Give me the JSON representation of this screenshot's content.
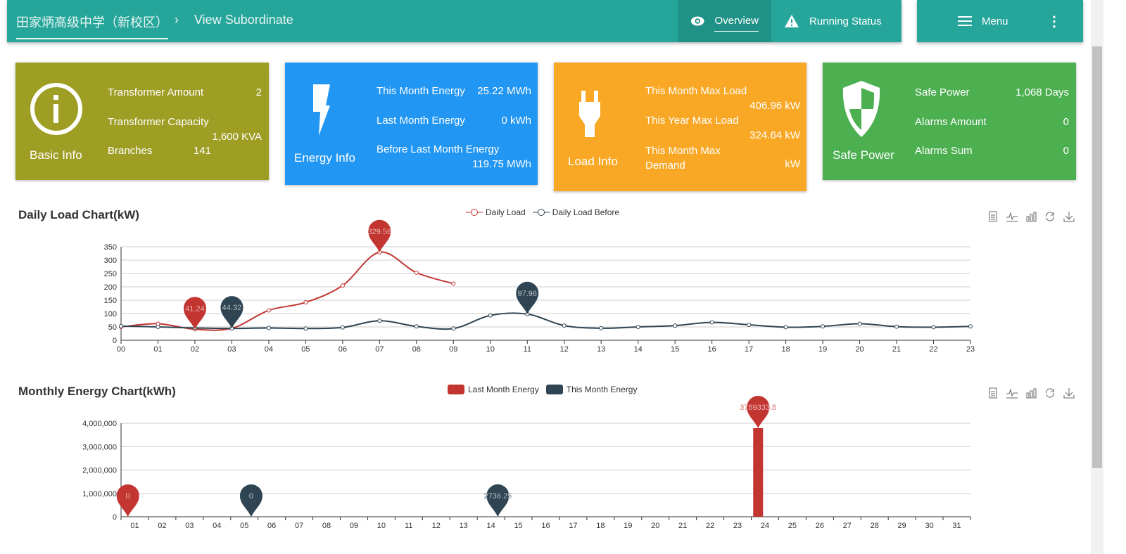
{
  "header": {
    "breadcrumb_root": "田家炳高级中学（新校区）",
    "breadcrumb_sep": "›",
    "breadcrumb_current": "View Subordinate",
    "nav": [
      {
        "label": "Overview",
        "icon": "eye-icon",
        "active": true
      },
      {
        "label": "Running Status",
        "icon": "warning-icon"
      }
    ],
    "menu_label": "Menu",
    "more": "⋮"
  },
  "colors": {
    "teal": "#26a69a",
    "basic": "#9e9d24",
    "energy": "#2196f3",
    "load": "#f9a825",
    "safe": "#4caf50",
    "series_red": "#c23531",
    "series_dark": "#2f4554"
  },
  "cards": [
    {
      "title": "Basic Info",
      "icon": "info-icon",
      "rows": [
        {
          "label": "Transformer Amount",
          "value": "2"
        },
        {
          "label": "Transformer Capacity",
          "value": "1,600 KVA"
        },
        {
          "label": "Branches",
          "value": "141"
        }
      ]
    },
    {
      "title": "Energy Info",
      "icon": "lightning-icon",
      "rows": [
        {
          "label": "This Month Energy",
          "value": "25.22 MWh"
        },
        {
          "label": "Last Month Energy",
          "value": "0 kWh"
        },
        {
          "label": "Before Last Month Energy",
          "value": "119.75 MWh"
        }
      ]
    },
    {
      "title": "Load Info",
      "icon": "plug-icon",
      "rows": [
        {
          "label": "This Month Max Load",
          "value": "406.96 kW"
        },
        {
          "label": "This Year Max Load",
          "value": "324.64 kW"
        },
        {
          "label": "This Month Max Demand",
          "value": "kW"
        }
      ]
    },
    {
      "title": "Safe Power",
      "icon": "shield-icon",
      "rows": [
        {
          "label": "Safe Power",
          "value": "1,068 Days"
        },
        {
          "label": "Alarms Amount",
          "value": "0"
        },
        {
          "label": "Alarms Sum",
          "value": "0"
        }
      ]
    }
  ],
  "toolbox": [
    "data-view-icon",
    "line-chart-icon",
    "bar-chart-icon",
    "restore-icon",
    "download-icon"
  ],
  "chart_data": [
    {
      "type": "line",
      "title": "Daily Load Chart(kW)",
      "ylim": [
        0,
        350
      ],
      "yticks": [
        "0",
        "50",
        "100",
        "150",
        "200",
        "250",
        "300",
        "350"
      ],
      "grid": true,
      "legend": "top-center",
      "categories": [
        "00",
        "01",
        "02",
        "03",
        "04",
        "05",
        "06",
        "07",
        "08",
        "09",
        "10",
        "11",
        "12",
        "13",
        "14",
        "15",
        "16",
        "17",
        "18",
        "19",
        "20",
        "21",
        "22",
        "23"
      ],
      "series": [
        {
          "name": "Daily Load",
          "color": "#c23531",
          "values": [
            50,
            62,
            41.24,
            45,
            112,
            142,
            205,
            329.56,
            253,
            212
          ],
          "markers": [
            {
              "index": 2,
              "label": "41.24"
            },
            {
              "index": 7,
              "label": "329.56"
            }
          ]
        },
        {
          "name": "Daily Load Before",
          "color": "#2f4554",
          "values": [
            53,
            50,
            46,
            44.32,
            46,
            44,
            48,
            73,
            52,
            44,
            93,
            97.96,
            55,
            45,
            50,
            55,
            67,
            58,
            49,
            52,
            62,
            51,
            49,
            52
          ],
          "markers": [
            {
              "index": 3,
              "label": "44.32"
            },
            {
              "index": 11,
              "label": "97.96"
            }
          ]
        }
      ]
    },
    {
      "type": "bar",
      "title": "Monthly Energy Chart(kWh)",
      "ylim": [
        0,
        4000000
      ],
      "yticks": [
        "0",
        "1,000,000",
        "2,000,000",
        "3,000,000",
        "4,000,000"
      ],
      "grid": true,
      "legend": "top-center",
      "categories": [
        "01",
        "02",
        "03",
        "04",
        "05",
        "06",
        "07",
        "08",
        "09",
        "10",
        "11",
        "12",
        "13",
        "14",
        "15",
        "16",
        "17",
        "18",
        "19",
        "20",
        "21",
        "22",
        "23",
        "24",
        "25",
        "26",
        "27",
        "28",
        "29",
        "30",
        "31"
      ],
      "series": [
        {
          "name": "Last Month Energy",
          "color": "#c23531",
          "values": {
            "24": 3789333.5
          },
          "markers": [
            {
              "index": 0,
              "label": "0"
            },
            {
              "index": 23,
              "label": "3789333.5"
            }
          ]
        },
        {
          "name": "This Month Energy",
          "color": "#2f4554",
          "values": {
            "14": 2736.25
          },
          "markers": [
            {
              "index": 4,
              "label": "0"
            },
            {
              "index": 13,
              "label": "2736.25"
            }
          ]
        }
      ]
    }
  ]
}
